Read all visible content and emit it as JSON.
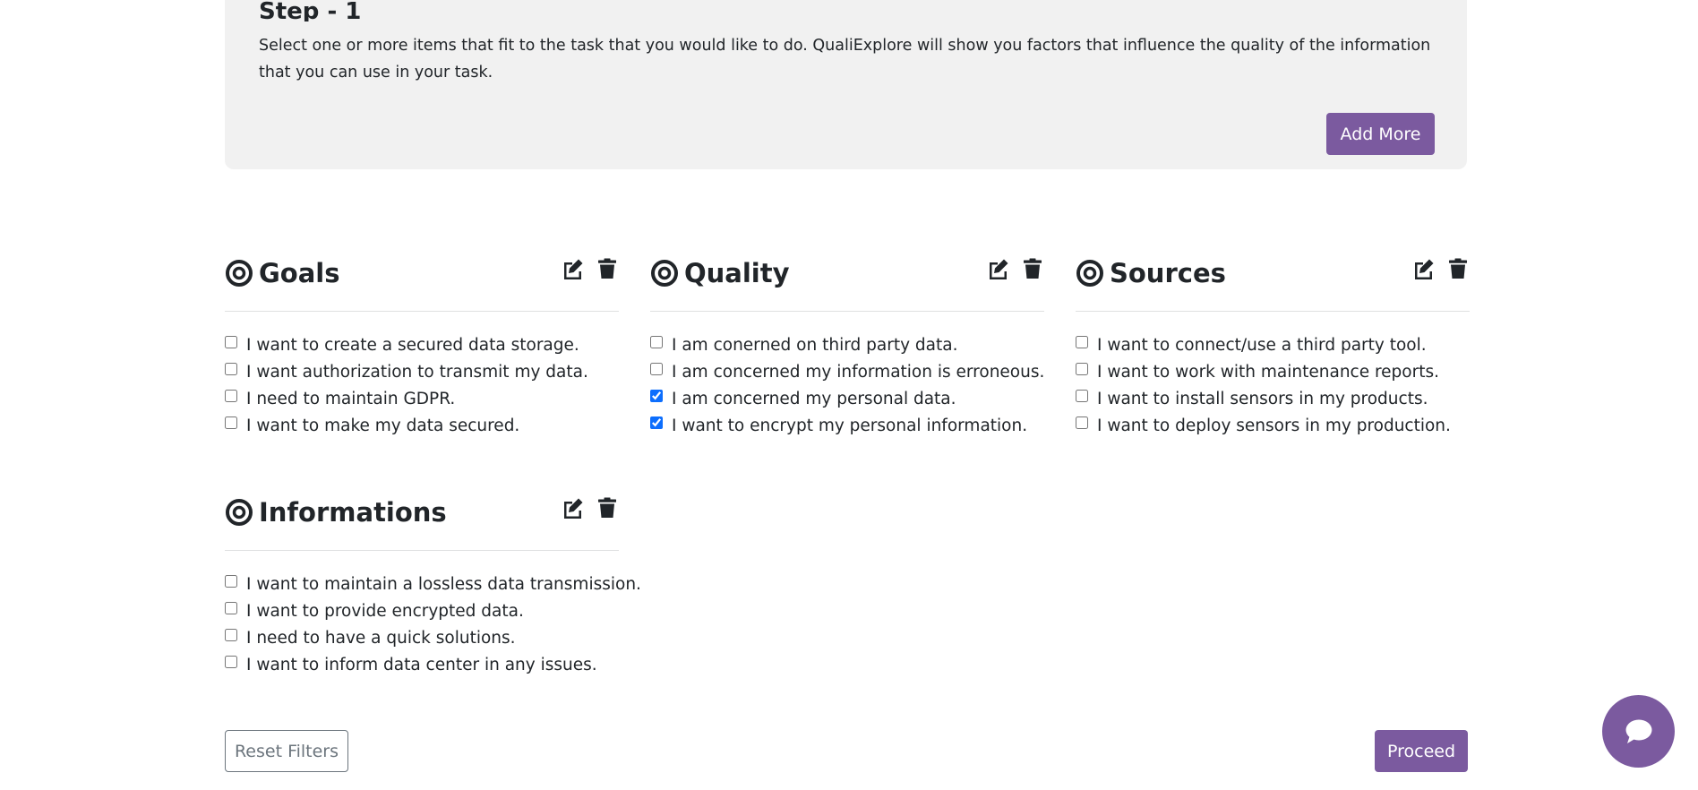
{
  "step": {
    "title": "Step - 1",
    "description": "Select one or more items that fit to the task that you would like to do. QualiExplore will show you factors that influence the quality of the information that you can use in your task.",
    "add_more_label": "Add More"
  },
  "sections": [
    {
      "title": "Goals",
      "items": [
        {
          "label": "I want to create a secured data storage.",
          "checked": false
        },
        {
          "label": "I want authorization to transmit my data.",
          "checked": false
        },
        {
          "label": "I need to maintain GDPR.",
          "checked": false
        },
        {
          "label": "I want to make my data secured.",
          "checked": false
        }
      ]
    },
    {
      "title": "Quality",
      "items": [
        {
          "label": "I am conerned on third party data.",
          "checked": false
        },
        {
          "label": "I am concerned my information is erroneous.",
          "checked": false
        },
        {
          "label": "I am concerned my personal data.",
          "checked": true
        },
        {
          "label": "I want to encrypt my personal information.",
          "checked": true
        }
      ]
    },
    {
      "title": "Sources",
      "items": [
        {
          "label": "I want to connect/use a third party tool.",
          "checked": false
        },
        {
          "label": "I want to work with maintenance reports.",
          "checked": false
        },
        {
          "label": "I want to install sensors in my products.",
          "checked": false
        },
        {
          "label": "I want to deploy sensors in my production.",
          "checked": false
        }
      ]
    },
    {
      "title": "Informations",
      "items": [
        {
          "label": "I want to maintain a lossless data transmission.",
          "checked": false
        },
        {
          "label": "I want to provide encrypted data.",
          "checked": false
        },
        {
          "label": "I need to have a quick solutions.",
          "checked": false
        },
        {
          "label": "I want to inform data center in any issues.",
          "checked": false
        }
      ]
    }
  ],
  "footer": {
    "reset_label": "Reset Filters",
    "proceed_label": "Proceed"
  },
  "icons": {
    "section": "target-icon",
    "edit": "edit-icon",
    "delete": "trash-icon",
    "chat": "chat-bubble-icon"
  },
  "colors": {
    "accent": "#7b5a9f",
    "panel_bg": "#f1f1f1",
    "text": "#212529",
    "secondary": "#6c757d"
  }
}
